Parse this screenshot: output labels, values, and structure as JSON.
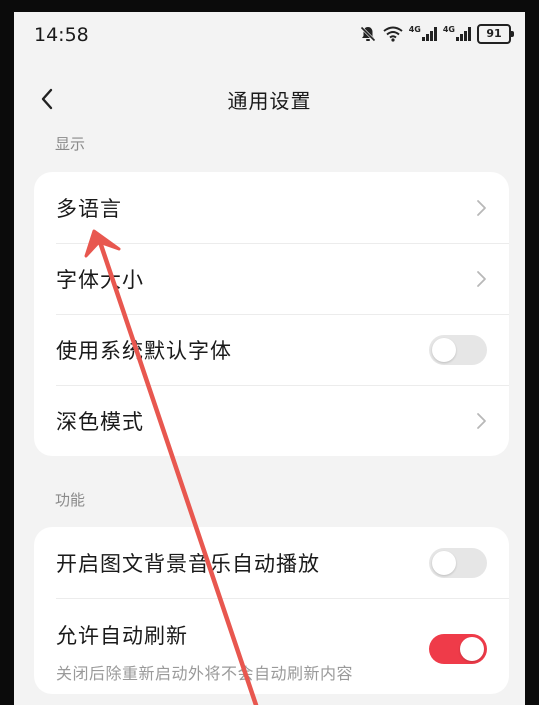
{
  "status_bar": {
    "time": "14:58",
    "network_1": "4G",
    "network_2": "4G",
    "battery": "91",
    "icons": [
      "bell-muted-icon",
      "wifi-icon",
      "signal-icon",
      "signal-icon",
      "battery-icon"
    ]
  },
  "header": {
    "title": "通用设置",
    "back_icon": "chevron-left-icon"
  },
  "sections": [
    {
      "label": "显示",
      "rows": [
        {
          "label": "多语言",
          "control": "chevron"
        },
        {
          "label": "字体大小",
          "control": "chevron"
        },
        {
          "label": "使用系统默认字体",
          "control": "toggle",
          "on": false
        },
        {
          "label": "深色模式",
          "control": "chevron"
        }
      ]
    },
    {
      "label": "功能",
      "rows": [
        {
          "label": "开启图文背景音乐自动播放",
          "control": "toggle",
          "on": false
        },
        {
          "label": "允许自动刷新",
          "description": "关闭后除重新启动外将不会自动刷新内容",
          "control": "toggle",
          "on": true
        }
      ]
    }
  ],
  "colors": {
    "accent": "#ef3b49",
    "annotation_arrow": "#e8574f",
    "background": "#f3f3f3",
    "card": "#ffffff"
  }
}
